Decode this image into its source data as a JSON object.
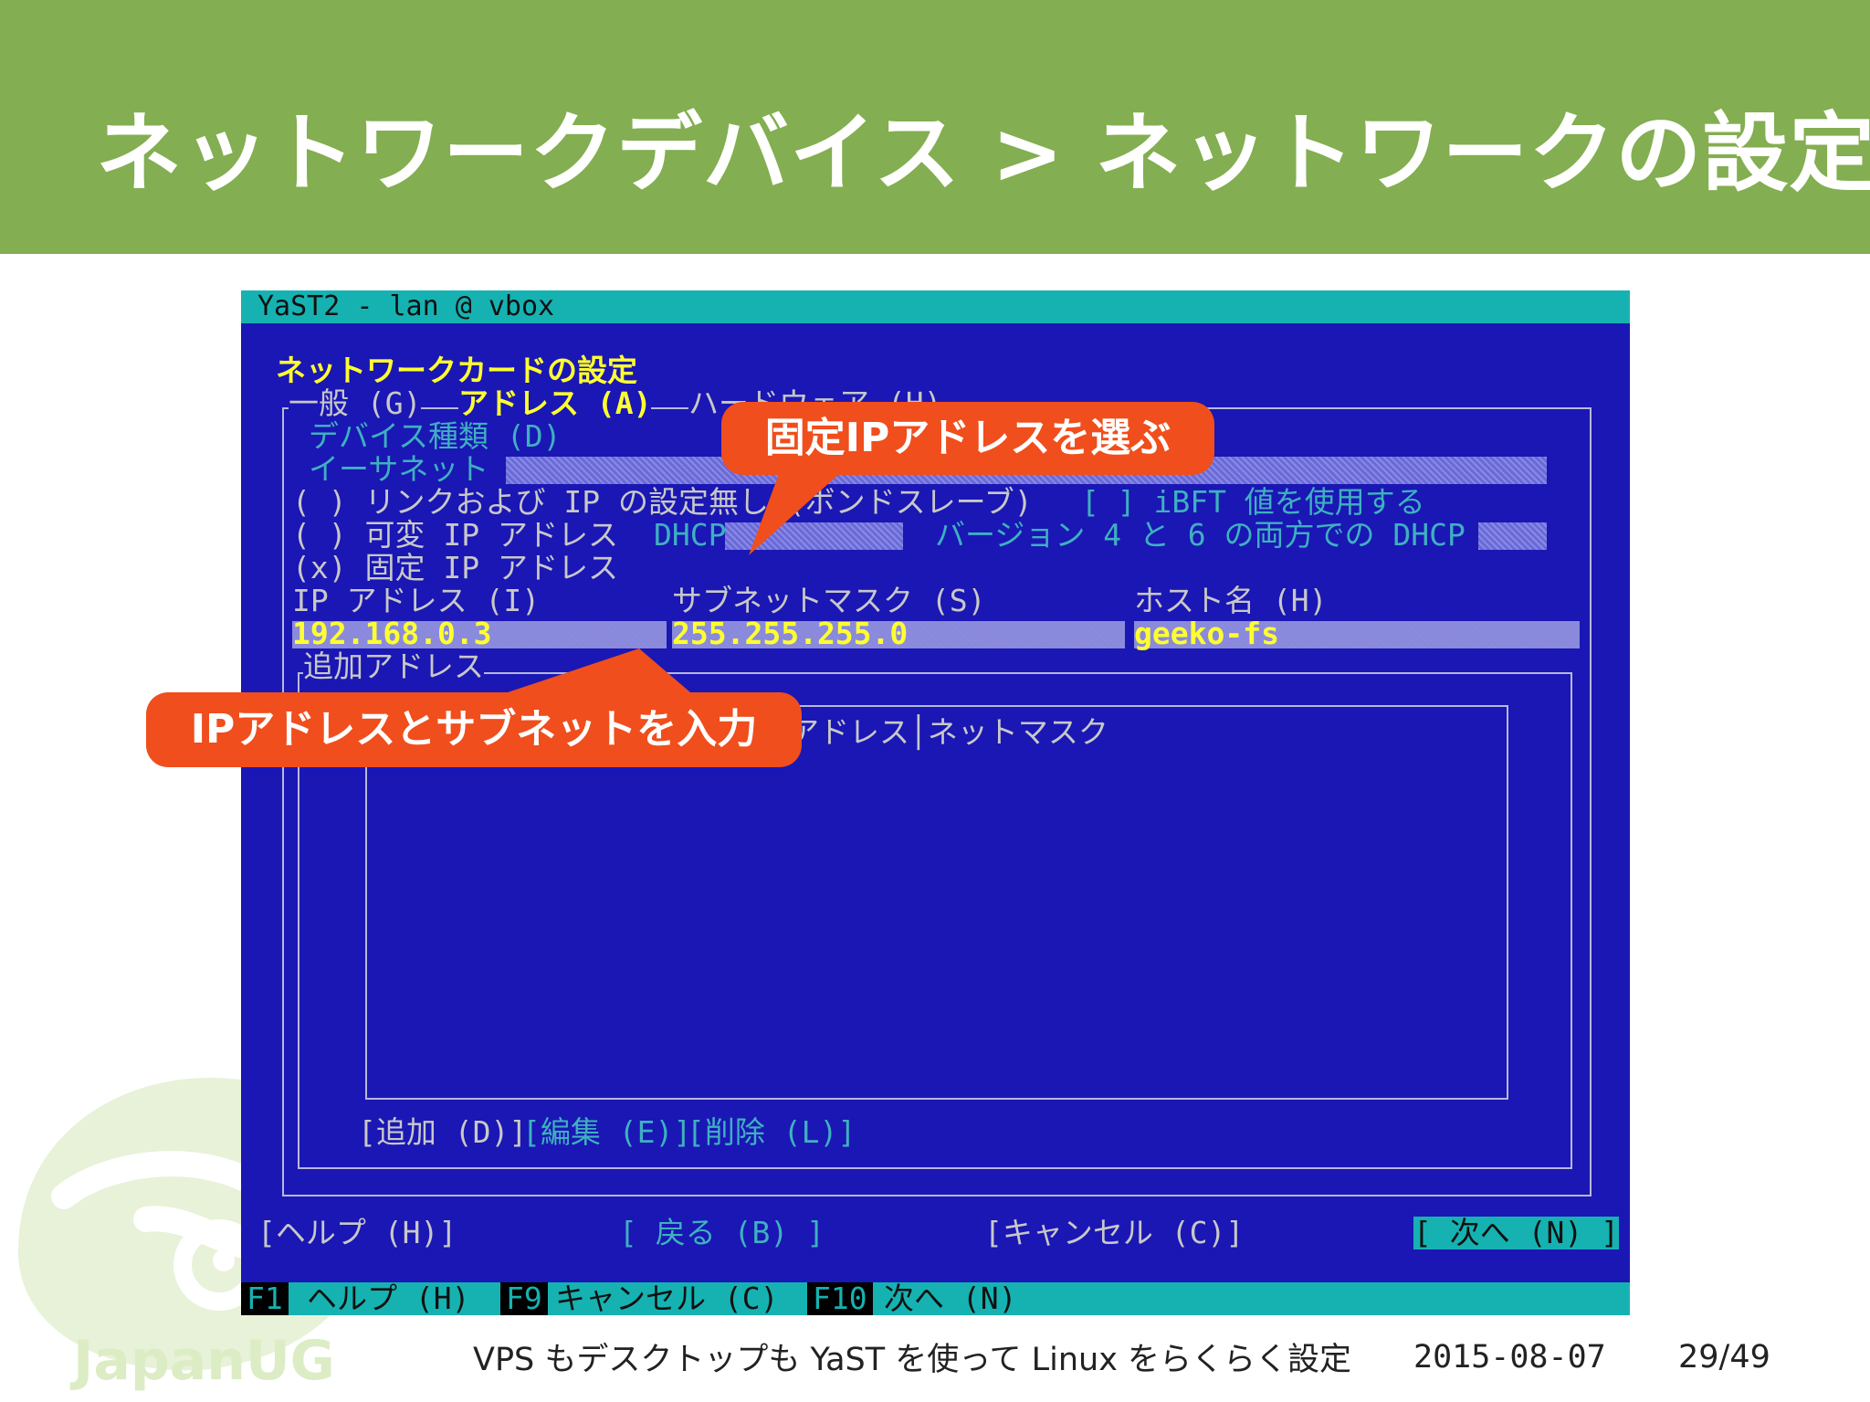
{
  "slide": {
    "title": "ネットワークデバイス > ネットワークの設定",
    "footer_text": "VPS もデスクトップも YaST を使って Linux をらくらく設定",
    "date": "2015-08-07",
    "page": "29/49",
    "watermark": "JapanUG"
  },
  "callouts": {
    "static_ip": "固定IPアドレスを選ぶ",
    "ip_subnet": "IPアドレスとサブネットを入力"
  },
  "terminal": {
    "title": "YaST2 - lan @ vbox",
    "dialog_title": "ネットワークカードの設定",
    "tabs": {
      "general": "一般 (G)",
      "address": "アドレス (A)",
      "hardware": "ハードウェア (H)"
    },
    "device_type_label": "デバイス種類 (D)",
    "device_type_value": "イーサネット",
    "options": {
      "no_link": "( ) リンクおよび IP の設定無し (ボンドスレーブ)",
      "ibft": "[ ] iBFT 値を使用する",
      "dynamic": "( ) 可変 IP アドレス",
      "dhcp": "DHCP",
      "dhcp_version": "バージョン 4 と 6 の両方での DHCP",
      "static": "(x) 固定 IP アドレス"
    },
    "fields": {
      "ip_label": "IP アドレス (I)",
      "ip_value": "192.168.0.3",
      "subnet_label": "サブネットマスク (S)",
      "subnet_value": "255.255.255.0",
      "hostname_label": "ホスト名 (H)",
      "hostname_value": "geeko-fs"
    },
    "additional": {
      "label": "追加アドレス",
      "columns": "アドレス│ネットマスク",
      "add": "[追加 (D)]",
      "edit": "[編集 (E)]",
      "delete": "[削除 (L)]"
    },
    "buttons": {
      "help": "[ヘルプ (H)]",
      "back": "[ 戻る (B) ]",
      "cancel": "[キャンセル (C)]",
      "next": "[ 次へ (N) ]"
    },
    "fkeys": [
      {
        "key": "F1",
        "label": "ヘルプ (H)"
      },
      {
        "key": "F9",
        "label": "キャンセル (C)"
      },
      {
        "key": "F10",
        "label": "次へ (N)"
      }
    ]
  }
}
